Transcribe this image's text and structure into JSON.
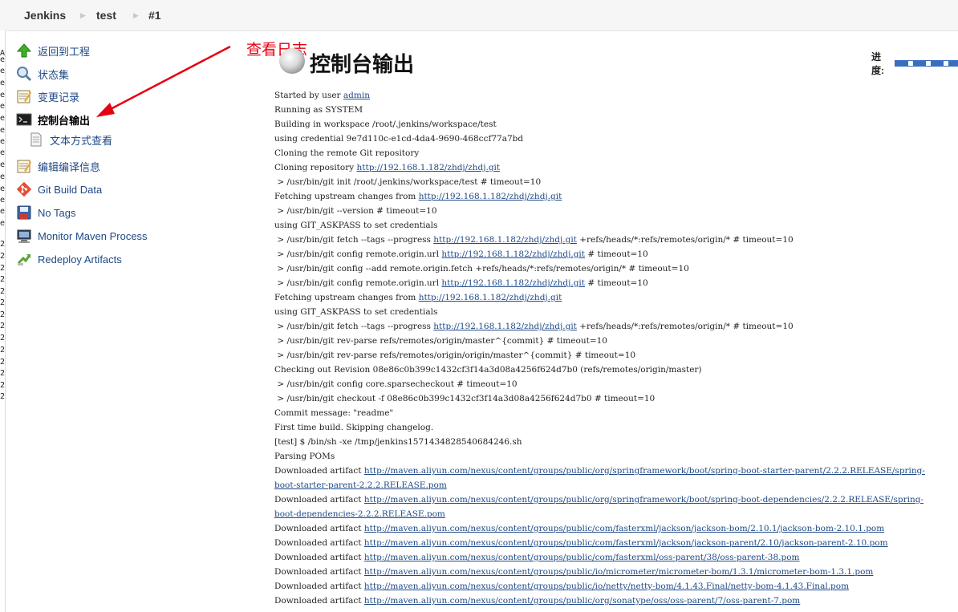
{
  "breadcrumb": [
    "Jenkins",
    "test",
    "#1"
  ],
  "sidebar": {
    "items": [
      {
        "label": "返回到工程",
        "icon": "up-arrow-icon"
      },
      {
        "label": "状态集",
        "icon": "magnifier-icon"
      },
      {
        "label": "变更记录",
        "icon": "notepad-icon"
      },
      {
        "label": "控制台输出",
        "icon": "terminal-icon",
        "active": true
      },
      {
        "label": "文本方式查看",
        "icon": "document-icon",
        "sub": true
      },
      {
        "label": "编辑编译信息",
        "icon": "notepad-icon"
      },
      {
        "label": "Git Build Data",
        "icon": "git-icon"
      },
      {
        "label": "No Tags",
        "icon": "save-icon"
      },
      {
        "label": "Monitor Maven Process",
        "icon": "computer-icon"
      },
      {
        "label": "Redeploy Artifacts",
        "icon": "redeploy-icon"
      }
    ]
  },
  "annotation": {
    "text": "查看日志",
    "color": "#e60012"
  },
  "heading": {
    "title": "控制台输出",
    "progress_label": "进度:"
  },
  "console": {
    "lines": [
      [
        {
          "t": "Started by user "
        },
        {
          "t": "admin",
          "link": true
        }
      ],
      [
        {
          "t": "Running as SYSTEM"
        }
      ],
      [
        {
          "t": "Building in workspace /root/.jenkins/workspace/test"
        }
      ],
      [
        {
          "t": "using credential 9e7d110c-e1cd-4da4-9690-468ccf77a7bd"
        }
      ],
      [
        {
          "t": "Cloning the remote Git repository"
        }
      ],
      [
        {
          "t": "Cloning repository "
        },
        {
          "t": "http://192.168.1.182/zhdj/zhdj.git",
          "link": true
        }
      ],
      [
        {
          "t": " > /usr/bin/git init /root/.jenkins/workspace/test # timeout=10"
        }
      ],
      [
        {
          "t": "Fetching upstream changes from "
        },
        {
          "t": "http://192.168.1.182/zhdj/zhdj.git",
          "link": true
        }
      ],
      [
        {
          "t": " > /usr/bin/git --version # timeout=10"
        }
      ],
      [
        {
          "t": "using GIT_ASKPASS to set credentials"
        }
      ],
      [
        {
          "t": " > /usr/bin/git fetch --tags --progress "
        },
        {
          "t": "http://192.168.1.182/zhdj/zhdj.git",
          "link": true
        },
        {
          "t": " +refs/heads/*:refs/remotes/origin/* # timeout=10"
        }
      ],
      [
        {
          "t": " > /usr/bin/git config remote.origin.url "
        },
        {
          "t": "http://192.168.1.182/zhdj/zhdj.git",
          "link": true
        },
        {
          "t": " # timeout=10"
        }
      ],
      [
        {
          "t": " > /usr/bin/git config --add remote.origin.fetch +refs/heads/*:refs/remotes/origin/* # timeout=10"
        }
      ],
      [
        {
          "t": " > /usr/bin/git config remote.origin.url "
        },
        {
          "t": "http://192.168.1.182/zhdj/zhdj.git",
          "link": true
        },
        {
          "t": " # timeout=10"
        }
      ],
      [
        {
          "t": "Fetching upstream changes from "
        },
        {
          "t": "http://192.168.1.182/zhdj/zhdj.git",
          "link": true
        }
      ],
      [
        {
          "t": "using GIT_ASKPASS to set credentials"
        }
      ],
      [
        {
          "t": " > /usr/bin/git fetch --tags --progress "
        },
        {
          "t": "http://192.168.1.182/zhdj/zhdj.git",
          "link": true
        },
        {
          "t": " +refs/heads/*:refs/remotes/origin/* # timeout=10"
        }
      ],
      [
        {
          "t": " > /usr/bin/git rev-parse refs/remotes/origin/master^{commit} # timeout=10"
        }
      ],
      [
        {
          "t": " > /usr/bin/git rev-parse refs/remotes/origin/origin/master^{commit} # timeout=10"
        }
      ],
      [
        {
          "t": "Checking out Revision 08e86c0b399c1432cf3f14a3d08a4256f624d7b0 (refs/remotes/origin/master)"
        }
      ],
      [
        {
          "t": " > /usr/bin/git config core.sparsecheckout # timeout=10"
        }
      ],
      [
        {
          "t": " > /usr/bin/git checkout -f 08e86c0b399c1432cf3f14a3d08a4256f624d7b0 # timeout=10"
        }
      ],
      [
        {
          "t": "Commit message: \"readme\""
        }
      ],
      [
        {
          "t": "First time build. Skipping changelog."
        }
      ],
      [
        {
          "t": "[test] $ /bin/sh -xe /tmp/jenkins1571434828540684246.sh"
        }
      ],
      [
        {
          "t": "Parsing POMs"
        }
      ],
      [
        {
          "t": "Downloaded artifact "
        },
        {
          "t": "http://maven.aliyun.com/nexus/content/groups/public/org/springframework/boot/spring-boot-starter-parent/2.2.2.RELEASE/spring-",
          "link": true
        }
      ],
      [
        {
          "t": "boot-starter-parent-2.2.2.RELEASE.pom",
          "link": true
        }
      ],
      [
        {
          "t": "Downloaded artifact "
        },
        {
          "t": "http://maven.aliyun.com/nexus/content/groups/public/org/springframework/boot/spring-boot-dependencies/2.2.2.RELEASE/spring-",
          "link": true
        }
      ],
      [
        {
          "t": "boot-dependencies-2.2.2.RELEASE.pom",
          "link": true
        }
      ],
      [
        {
          "t": "Downloaded artifact "
        },
        {
          "t": "http://maven.aliyun.com/nexus/content/groups/public/com/fasterxml/jackson/jackson-bom/2.10.1/jackson-bom-2.10.1.pom",
          "link": true
        }
      ],
      [
        {
          "t": "Downloaded artifact "
        },
        {
          "t": "http://maven.aliyun.com/nexus/content/groups/public/com/fasterxml/jackson/jackson-parent/2.10/jackson-parent-2.10.pom",
          "link": true
        }
      ],
      [
        {
          "t": "Downloaded artifact "
        },
        {
          "t": "http://maven.aliyun.com/nexus/content/groups/public/com/fasterxml/oss-parent/38/oss-parent-38.pom",
          "link": true
        }
      ],
      [
        {
          "t": "Downloaded artifact "
        },
        {
          "t": "http://maven.aliyun.com/nexus/content/groups/public/io/micrometer/micrometer-bom/1.3.1/micrometer-bom-1.3.1.pom",
          "link": true
        }
      ],
      [
        {
          "t": "Downloaded artifact "
        },
        {
          "t": "http://maven.aliyun.com/nexus/content/groups/public/io/netty/netty-bom/4.1.43.Final/netty-bom-4.1.43.Final.pom",
          "link": true
        }
      ],
      [
        {
          "t": "Downloaded artifact "
        },
        {
          "t": "http://maven.aliyun.com/nexus/content/groups/public/org/sonatype/oss/oss-parent/7/oss-parent-7.pom",
          "link": true
        }
      ]
    ]
  },
  "edge_strip": [
    "A",
    "e",
    "e",
    "e",
    "e",
    "e",
    "e",
    "e",
    "e",
    "e",
    "e",
    "e",
    "e",
    "e",
    "e",
    "e",
    "2",
    "2",
    "2",
    "2",
    "2",
    "2",
    "2",
    "2",
    "2",
    "2",
    "2",
    "2",
    "2",
    "2"
  ]
}
